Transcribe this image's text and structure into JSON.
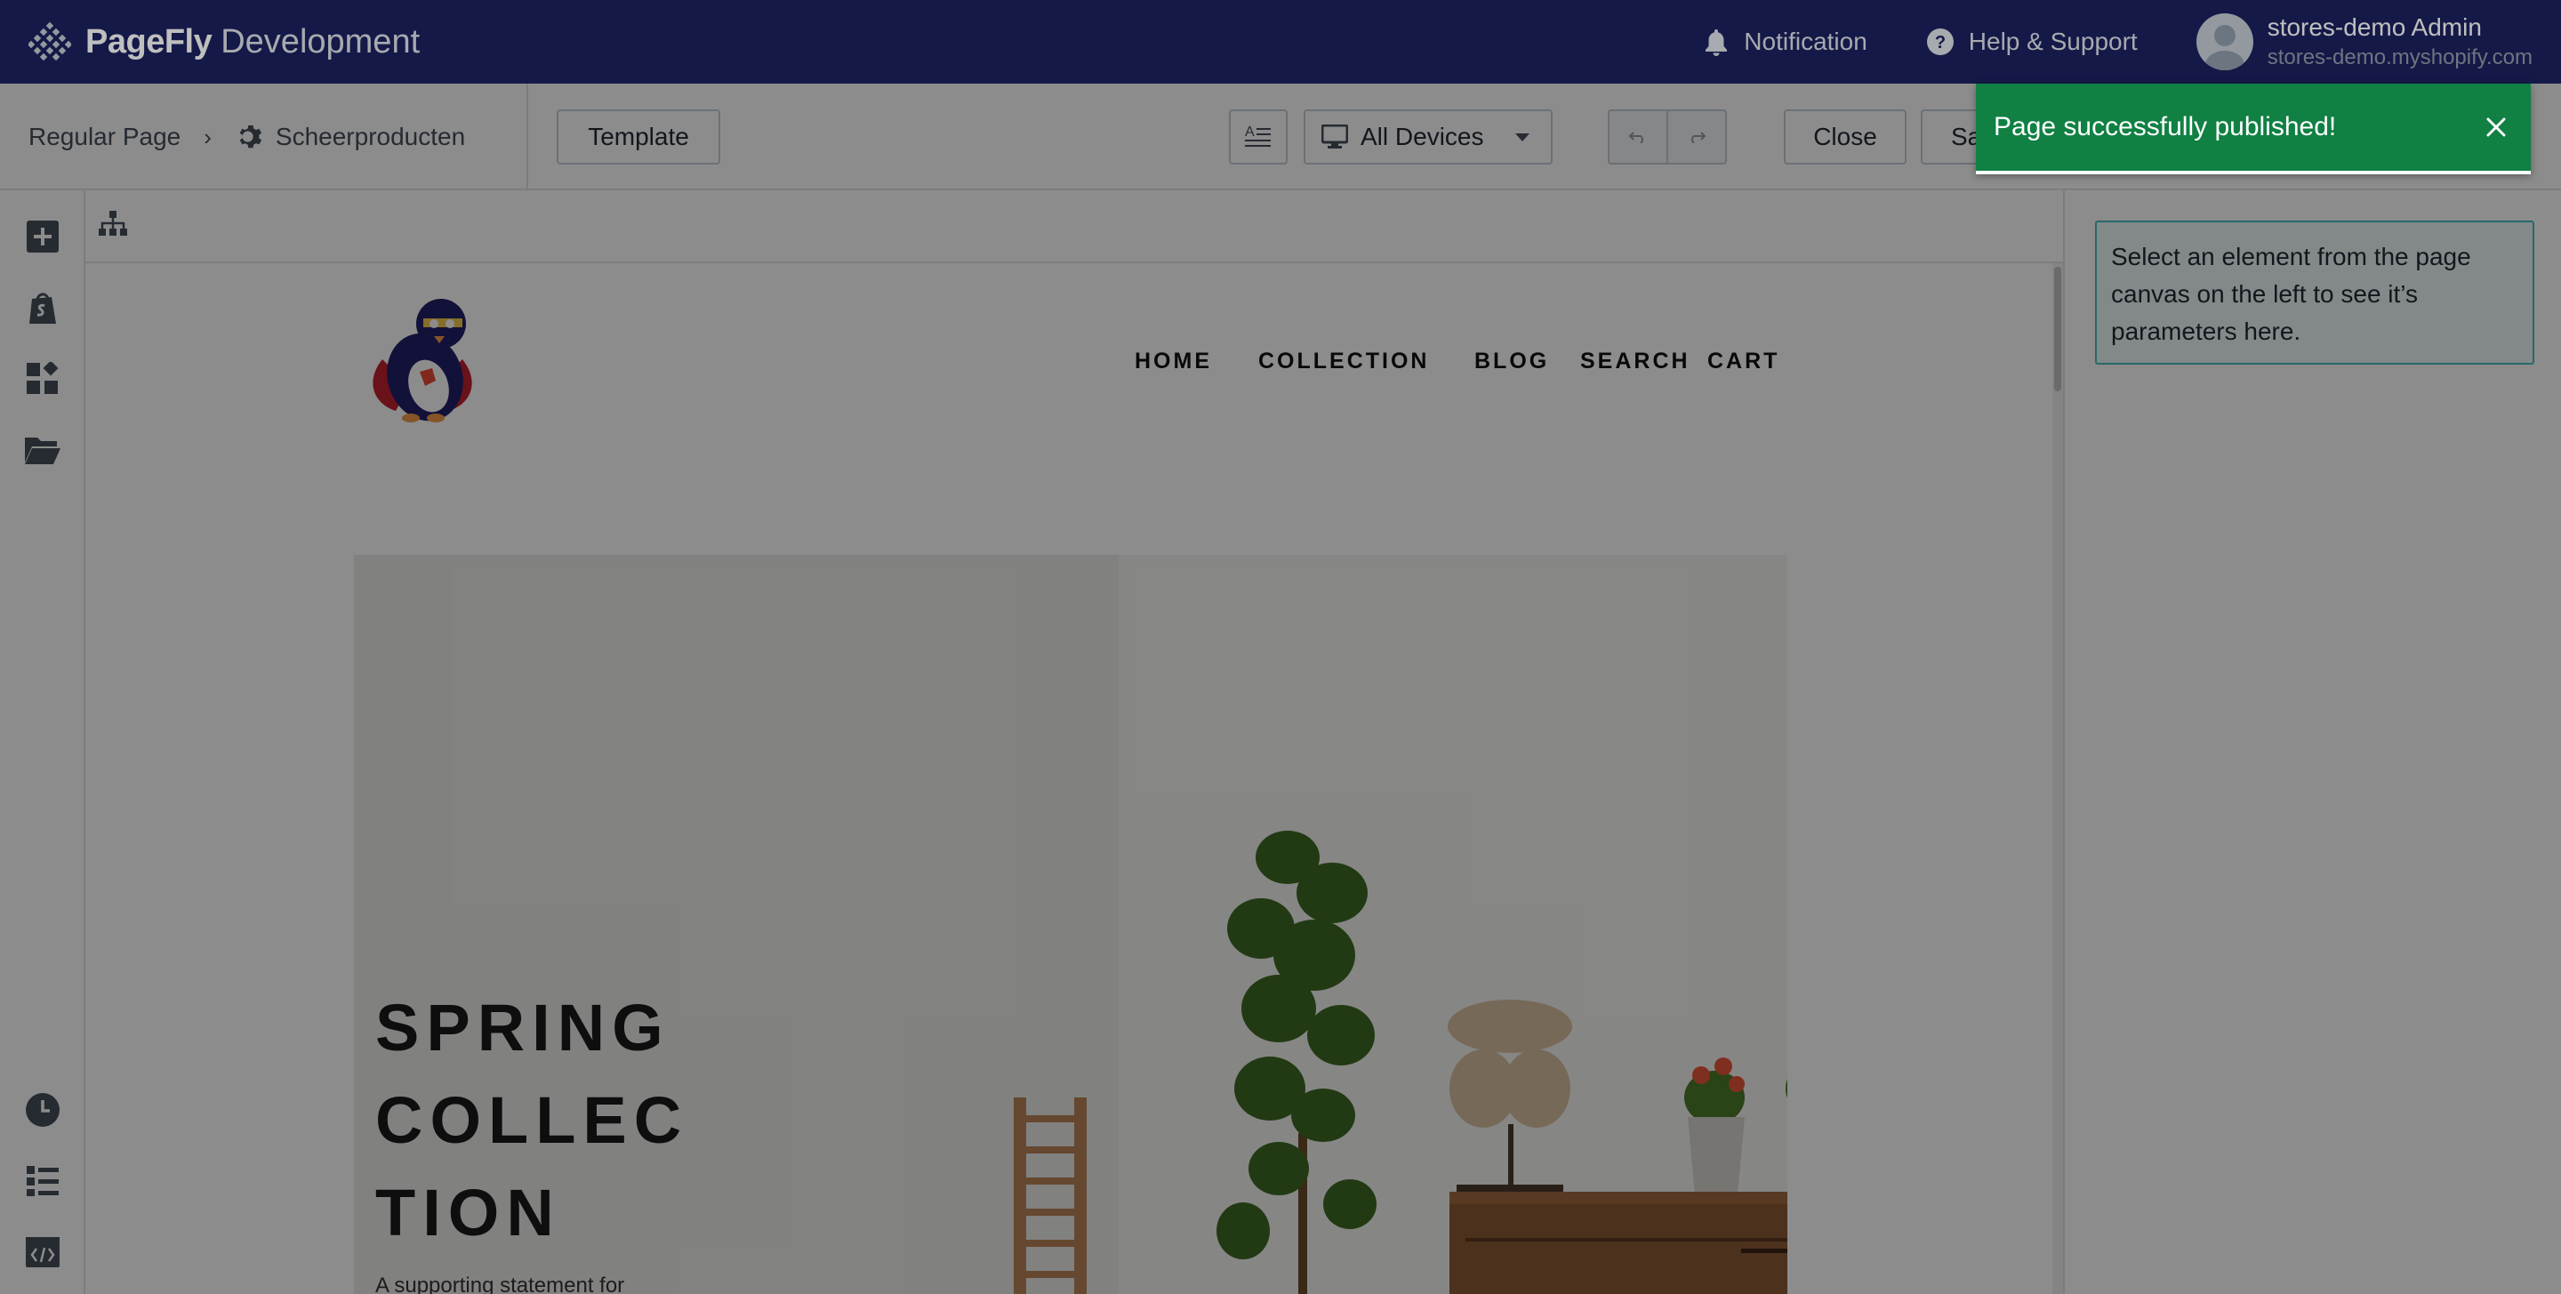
{
  "header": {
    "brand_name": "PageFly",
    "brand_env": "Development",
    "notification_label": "Notification",
    "help_label": "Help & Support",
    "user_name": "stores-demo Admin",
    "user_store": "stores-demo.myshopify.com"
  },
  "toolbar": {
    "breadcrumb_root": "Regular Page",
    "breadcrumb_page": "Scheerproducten",
    "template_label": "Template",
    "devices_label": "All Devices",
    "close_label": "Close",
    "save_label": "Sa"
  },
  "canvas": {
    "nav": [
      "HOME",
      "COLLECTION",
      "BLOG",
      "SEARCH",
      "CART"
    ],
    "hero_title_lines": [
      "SPRING",
      "COLLEC",
      "TION"
    ],
    "hero_subtitle": "A supporting statement for"
  },
  "right_panel": {
    "info_text": "Select an element from the page canvas on the left to see it’s parameters here."
  },
  "toast": {
    "message": "Page successfully published!"
  },
  "colors": {
    "topbar": "#1c2260",
    "toast": "#108043",
    "info_border": "#47c1bf"
  },
  "icons": {
    "sidebar_top": [
      "add-icon",
      "shopify-bag-icon",
      "widgets-icon",
      "folder-icon"
    ],
    "sidebar_bottom": [
      "history-icon",
      "list-icon",
      "code-icon"
    ]
  }
}
